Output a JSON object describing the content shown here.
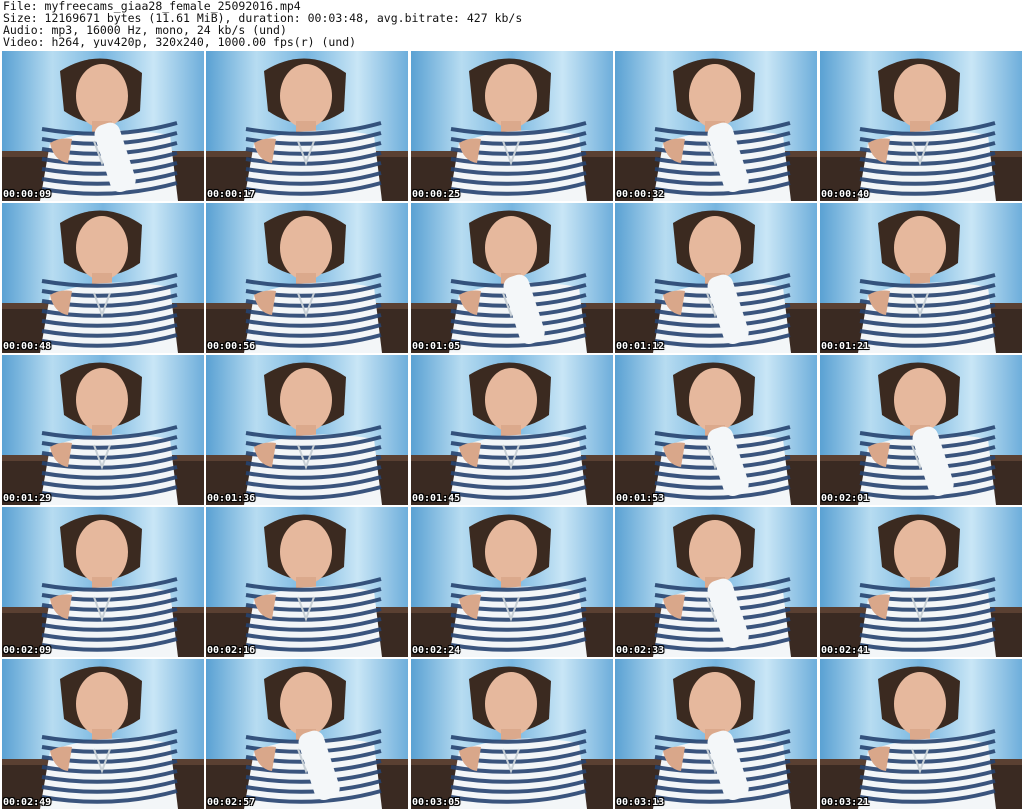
{
  "header": {
    "file": "File: myfreecams_giaa28_female_25092016.mp4",
    "size": "Size: 12169671 bytes (11.61 MiB), duration: 00:03:48, avg.bitrate: 427 kb/s",
    "audio": "Audio: mp3, 16000 Hz, mono, 24 kb/s (und)",
    "video": "Video: h264, yuv420p, 320x240, 1000.00 fps(r) (und)"
  },
  "thumbnails": [
    {
      "timestamp": "00:00:09"
    },
    {
      "timestamp": "00:00:17"
    },
    {
      "timestamp": "00:00:25"
    },
    {
      "timestamp": "00:00:32"
    },
    {
      "timestamp": "00:00:40"
    },
    {
      "timestamp": "00:00:48"
    },
    {
      "timestamp": "00:00:56"
    },
    {
      "timestamp": "00:01:05"
    },
    {
      "timestamp": "00:01:12"
    },
    {
      "timestamp": "00:01:21"
    },
    {
      "timestamp": "00:01:29"
    },
    {
      "timestamp": "00:01:36"
    },
    {
      "timestamp": "00:01:45"
    },
    {
      "timestamp": "00:01:53"
    },
    {
      "timestamp": "00:02:01"
    },
    {
      "timestamp": "00:02:09"
    },
    {
      "timestamp": "00:02:16"
    },
    {
      "timestamp": "00:02:24"
    },
    {
      "timestamp": "00:02:33"
    },
    {
      "timestamp": "00:02:41"
    },
    {
      "timestamp": "00:02:49"
    },
    {
      "timestamp": "00:02:57"
    },
    {
      "timestamp": "00:03:05"
    },
    {
      "timestamp": "00:03:13"
    },
    {
      "timestamp": "00:03:21"
    }
  ],
  "colors": {
    "background": "#ffffff",
    "header_text": "#111111",
    "timestamp_text": "#ffffff"
  }
}
